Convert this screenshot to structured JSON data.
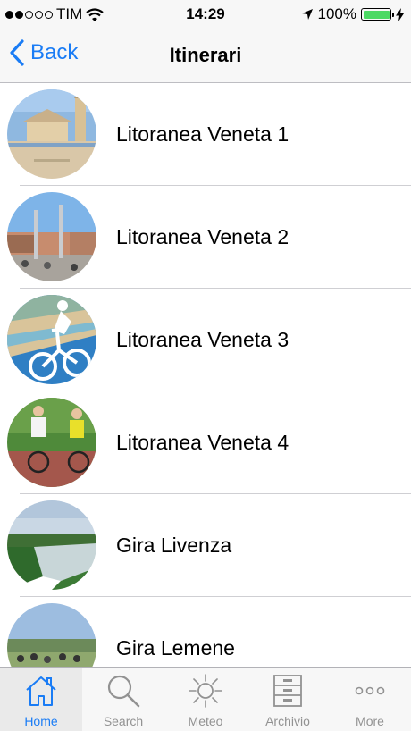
{
  "status_bar": {
    "carrier": "TIM",
    "time": "14:29",
    "battery": "100%",
    "signal_bars_filled": 2,
    "signal_bars_total": 5,
    "battery_level": 1.0,
    "battery_color": "#4cd964"
  },
  "nav": {
    "back_label": "Back",
    "title": "Itinerari",
    "accent_color": "#1a7cf5"
  },
  "list": {
    "items": [
      {
        "label": "Litoranea Veneta 1",
        "icon": "church-beach-photo"
      },
      {
        "label": "Litoranea Veneta 2",
        "icon": "town-square-photo"
      },
      {
        "label": "Litoranea Veneta 3",
        "icon": "cyclist-silhouette-photo"
      },
      {
        "label": "Litoranea Veneta 4",
        "icon": "cyclists-photo"
      },
      {
        "label": "Gira Livenza",
        "icon": "river-photo"
      },
      {
        "label": "Gira Lemene",
        "icon": "riverside-path-photo"
      }
    ]
  },
  "tabbar": {
    "tabs": [
      {
        "label": "Home",
        "icon": "home-icon",
        "active": true
      },
      {
        "label": "Search",
        "icon": "search-icon",
        "active": false
      },
      {
        "label": "Meteo",
        "icon": "sun-icon",
        "active": false
      },
      {
        "label": "Archivio",
        "icon": "archive-icon",
        "active": false
      },
      {
        "label": "More",
        "icon": "more-icon",
        "active": false
      }
    ],
    "active_color": "#1a7cf5",
    "inactive_color": "#929292"
  }
}
